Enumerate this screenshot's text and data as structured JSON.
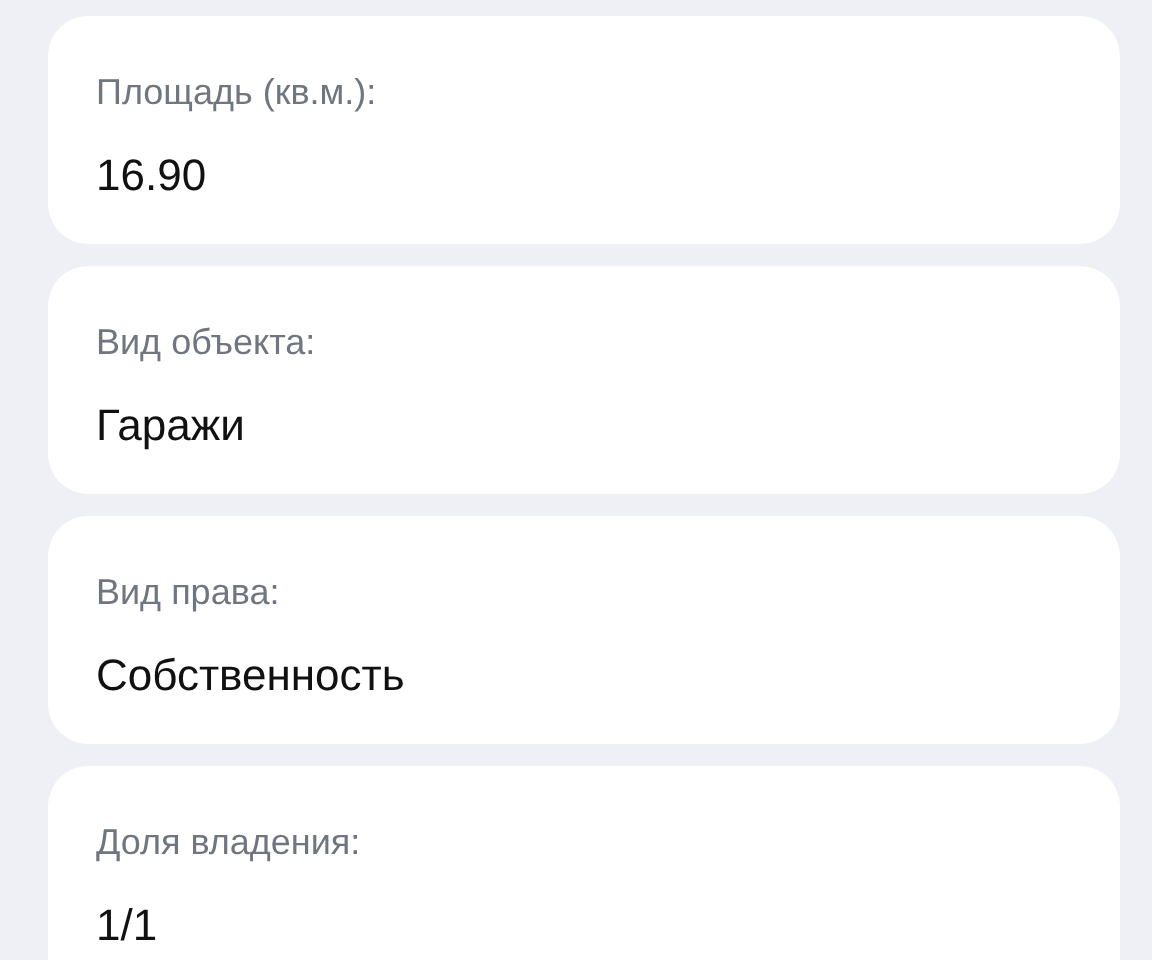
{
  "fields": [
    {
      "label": "Площадь (кв.м.):",
      "value": "16.90"
    },
    {
      "label": "Вид объекта:",
      "value": "Гаражи"
    },
    {
      "label": "Вид права:",
      "value": "Собственность"
    },
    {
      "label": "Доля владения:",
      "value": "1/1"
    }
  ]
}
